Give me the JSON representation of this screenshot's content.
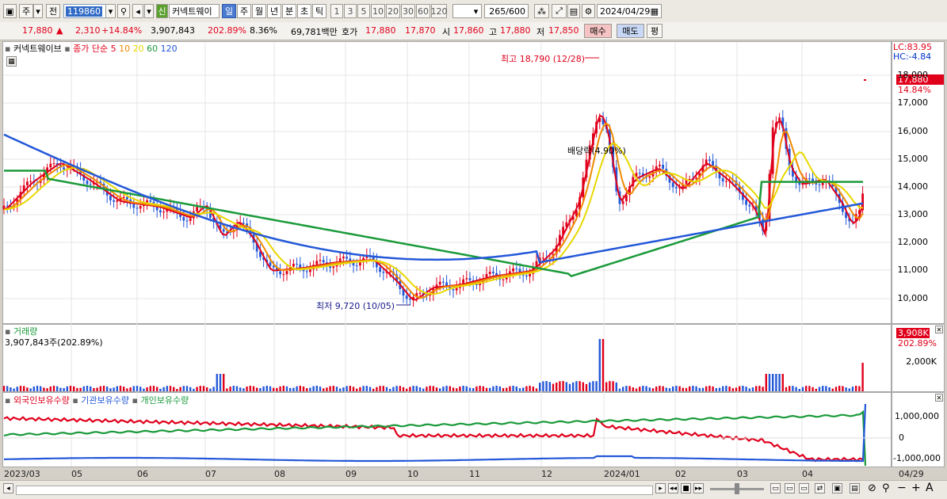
{
  "toolbar": {
    "market": "주",
    "type": "전",
    "code": "119860",
    "new_label": "신",
    "stock_name": "커넥트웨이",
    "periods": [
      "일",
      "주",
      "월",
      "년",
      "분",
      "초",
      "틱"
    ],
    "intervals": [
      "1",
      "3",
      "5",
      "10",
      "20",
      "30",
      "60",
      "120"
    ],
    "count": "265",
    "count_total": "/600",
    "date": "2024/04/29"
  },
  "price_row": {
    "price": "17,880",
    "change": "2,310",
    "change_pct": "+14.84%",
    "volume": "3,907,843",
    "vol_ratio": "202.89%",
    "turnover_pct": "8.36%",
    "amount": "69,781백만",
    "quote_label": "호가",
    "ask": "17,880",
    "bid": "17,870",
    "open_label": "시",
    "open": "17,860",
    "high_label": "고",
    "high": "17,880",
    "low_label": "저",
    "low": "17,850",
    "buy": "매수",
    "sell": "매도",
    "flat": "평"
  },
  "main_chart": {
    "title": "커넥트웨이브",
    "legend_label": "종가 단순",
    "ma_periods": [
      "5",
      "10",
      "20",
      "60",
      "120"
    ],
    "ma_colors": [
      "#e0001b",
      "#f08a00",
      "#e8d800",
      "#1a9a3a",
      "#2358d8"
    ],
    "lc": "LC:83.95",
    "hc": "HC:-4.84",
    "price_tag": "17,880",
    "pct_tag": "14.84%",
    "annot_high": "최고 18,790 (12/28)",
    "annot_low": "최저 9,720 (10/05)",
    "annot_dividend": "배당락(4.90%)",
    "y_ticks": [
      "18,000",
      "17,000",
      "16,000",
      "15,000",
      "14,000",
      "13,000",
      "12,000",
      "11,000",
      "10,000"
    ]
  },
  "volume_chart": {
    "title": "거래량",
    "value": "3,907,843주(202.89%)",
    "tag": "3,908K",
    "tag_pct": "202.89%",
    "y_ticks": [
      "2,000K"
    ]
  },
  "holding_chart": {
    "title_1": "외국인보유수량",
    "title_2": "기관보유수량",
    "title_3": "개인보유수량",
    "y_ticks": [
      "1,000,000",
      "0",
      "-1,000,000"
    ]
  },
  "x_axis": [
    "2023/03",
    "05",
    "06",
    "07",
    "08",
    "09",
    "10",
    "11",
    "12",
    "2024/01",
    "02",
    "03",
    "04",
    "04/29"
  ]
}
